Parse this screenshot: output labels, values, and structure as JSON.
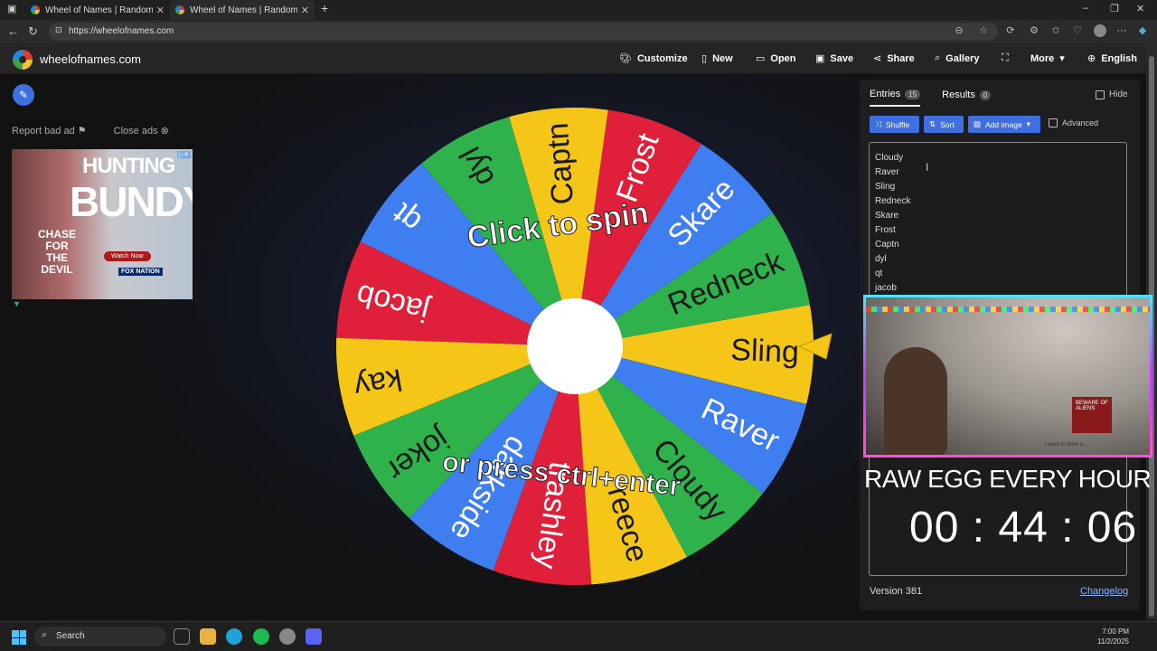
{
  "browser": {
    "tabs": [
      {
        "title": "Wheel of Names | Random name"
      },
      {
        "title": "Wheel of Names | Random name"
      }
    ],
    "url": "https://wheelofnames.com"
  },
  "site": {
    "name": "wheelofnames.com",
    "menu": [
      "Customize",
      "New",
      "Open",
      "Save",
      "Share",
      "Gallery",
      "More",
      "English"
    ]
  },
  "ad": {
    "report_label": "Report bad ad",
    "close_label": "Close ads",
    "headline_line1": "HUNTING",
    "headline_line2": "BUNDY",
    "tagline": "CHASE FOR THE DEVIL",
    "cta": "Watch Now",
    "network": "FOX NATION"
  },
  "wheel": {
    "instruction_top": "Click to spin",
    "instruction_bottom": "or press ctrl+enter",
    "segments": [
      "Sling",
      "Redneck",
      "Skare",
      "Frost",
      "Captn",
      "dyl",
      "qt",
      "jacob",
      "kay",
      "joker",
      "darkside",
      "trashley",
      "reece",
      "Cloudy",
      "Raver"
    ],
    "colors": [
      "#f5c518",
      "#2fb24c",
      "#3f7ef0",
      "#e0203a"
    ]
  },
  "panel": {
    "tabs": [
      {
        "label": "Entries",
        "count": "15"
      },
      {
        "label": "Results",
        "count": "0"
      }
    ],
    "hide_label": "Hide",
    "buttons": {
      "shuffle": "Shuffle",
      "sort": "Sort",
      "add_image": "Add image"
    },
    "advanced_label": "Advanced",
    "entries": [
      "Cloudy",
      "Raver",
      "Sling",
      "Redneck",
      "Skare",
      "Frost",
      "Captn",
      "dyl",
      "qt",
      "jacob"
    ],
    "version": "Version 381",
    "changelog": "Changelog"
  },
  "overlay": {
    "title": "RAW EGG EVERY HOUR",
    "timer": "00 : 44 : 06",
    "webcam_sign": "BEWARE OF ALIENS",
    "webcam_caption": "I want to think o..."
  },
  "taskbar": {
    "search_placeholder": "Search",
    "time": "7:00 PM",
    "date": "11/2/2025"
  }
}
